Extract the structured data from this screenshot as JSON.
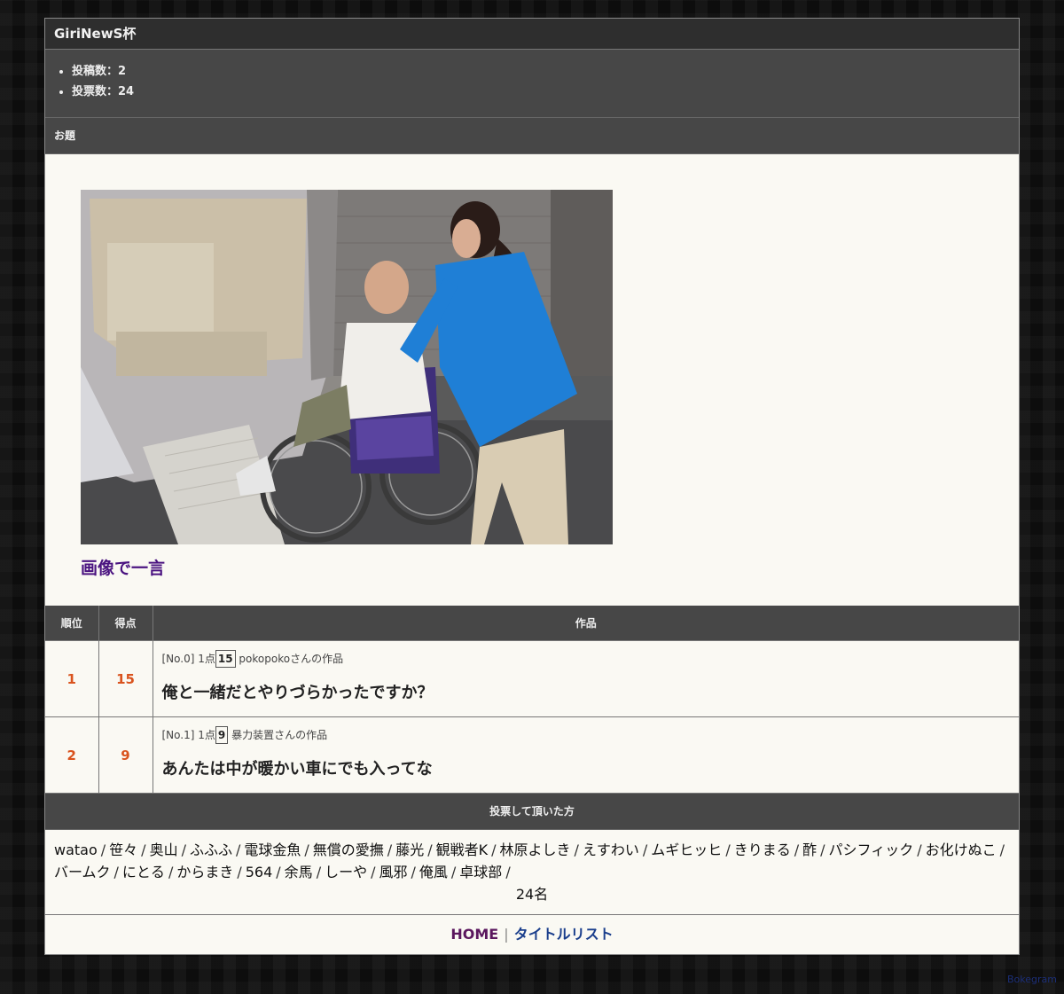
{
  "contest": {
    "title": "GiriNewS杯",
    "stats": [
      "投稿数：2",
      "投票数：24"
    ]
  },
  "theme_section": {
    "heading": "お題",
    "label": "画像で一言"
  },
  "results": {
    "headers": {
      "rank": "順位",
      "score": "得点",
      "work": "作品"
    },
    "rows": [
      {
        "rank": "1",
        "score": "15",
        "entry_no": "[No.0]",
        "unit": "1点",
        "points": "15",
        "author": "pokopokoさんの作品",
        "text": "俺と一緒だとやりづらかったですか？"
      },
      {
        "rank": "2",
        "score": "9",
        "entry_no": "[No.1]",
        "unit": "1点",
        "points": "9",
        "author": "暴力装置さんの作品",
        "text": "あんたは中が暖かい車にでも入ってな"
      }
    ]
  },
  "voters_section": {
    "heading": "投票して頂いた方",
    "names": [
      "watao",
      "笹々",
      "奥山",
      "ふふふ",
      "電球金魚",
      "無償の愛撫",
      "藤光",
      "観戦者K",
      "林原よしき",
      "えすわい",
      "ムギヒッヒ",
      "きりまる",
      "酢",
      "パシフィック",
      "お化けぬこ",
      "バームク",
      "にとる",
      "からまき",
      "564",
      "余馬",
      "しーや",
      "風邪",
      "俺風",
      "卓球部"
    ],
    "count": "24名"
  },
  "footer": {
    "home": "HOME",
    "title_list": "タイトルリスト",
    "brand": "Bokegram"
  }
}
